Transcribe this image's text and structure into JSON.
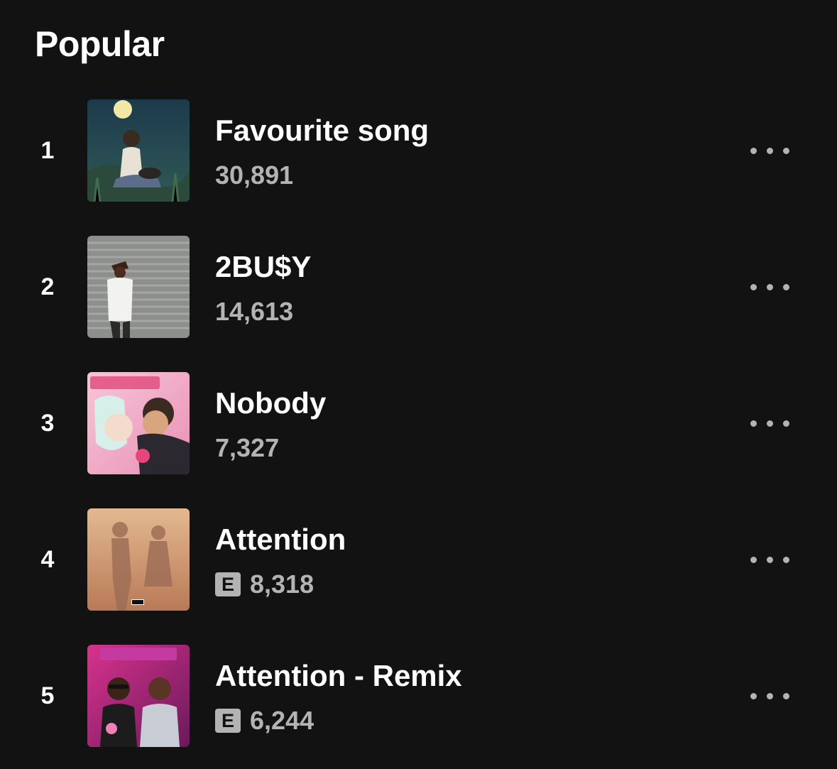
{
  "section": {
    "title": "Popular"
  },
  "tracks": [
    {
      "rank": "1",
      "title": "Favourite song",
      "plays": "30,891",
      "explicit": false,
      "explicit_label": ""
    },
    {
      "rank": "2",
      "title": "2BU$Y",
      "plays": "14,613",
      "explicit": false,
      "explicit_label": ""
    },
    {
      "rank": "3",
      "title": "Nobody",
      "plays": "7,327",
      "explicit": false,
      "explicit_label": ""
    },
    {
      "rank": "4",
      "title": "Attention",
      "plays": "8,318",
      "explicit": true,
      "explicit_label": "E"
    },
    {
      "rank": "5",
      "title": "Attention - Remix",
      "plays": "6,244",
      "explicit": true,
      "explicit_label": "E"
    }
  ],
  "icons": {
    "more": "more-horizontal-icon",
    "explicit": "explicit-badge-icon"
  },
  "colors": {
    "background": "#121212",
    "primary_text": "#ffffff",
    "secondary_text": "#b3b3b3"
  }
}
